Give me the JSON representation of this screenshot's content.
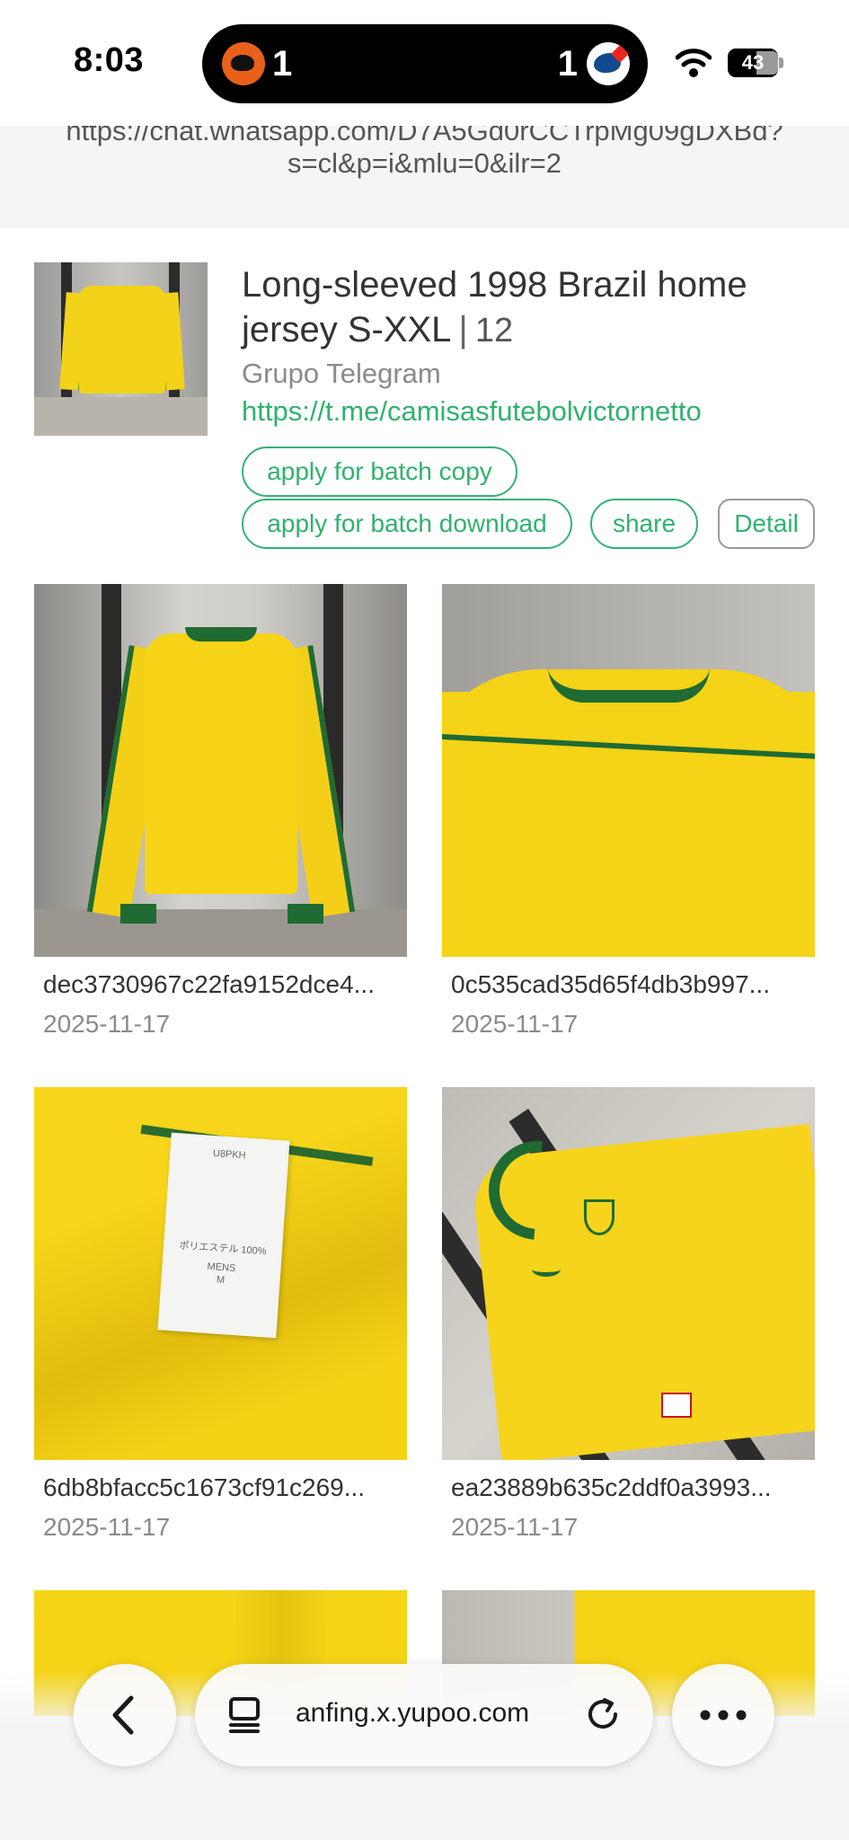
{
  "status_bar": {
    "time": "8:03",
    "live_activity": {
      "left_score": "1",
      "right_score": "1",
      "left_team_icon": "orioles-logo",
      "right_team_icon": "blue-jays-logo"
    },
    "battery": "43"
  },
  "link_strip": {
    "partial_line": "https://chat.whatsapp.com/D7A5Gd0rCCTrpMg09gDXBd?",
    "line": "s=cl&p=i&mlu=0&ilr=2"
  },
  "album": {
    "title": "Long-sleeved 1998 Brazil home jersey S-XXL",
    "separator": "|",
    "count": "12",
    "group": "Grupo Telegram",
    "link": "https://t.me/camisasfutebolvictornetto",
    "buttons": {
      "batch_copy": "apply for batch copy",
      "batch_download": "apply for batch download",
      "share": "share",
      "detail": "Detail"
    }
  },
  "photos": [
    {
      "name": "dec3730967c22fa9152dce4...",
      "date": "2025-11-17"
    },
    {
      "name": "0c535cad35d65f4db3b997...",
      "date": "2025-11-17"
    },
    {
      "name": "6db8bfacc5c1673cf91c269...",
      "date": "2025-11-17"
    },
    {
      "name": "ea23889b635c2ddf0a3993...",
      "date": "2025-11-17"
    }
  ],
  "care_label": {
    "code": "U8PKH",
    "material": "ポリエステル 100%",
    "size_line1": "MENS",
    "size_line2": "M"
  },
  "browser": {
    "url": "anfing.x.yupoo.com",
    "icons": [
      "back-chevron-icon",
      "tabs-icon",
      "reload-icon",
      "more-icon"
    ]
  },
  "colors": {
    "accent": "#2fb26e",
    "jersey_yellow": "#f5d316",
    "jersey_green": "#1f6b33"
  }
}
